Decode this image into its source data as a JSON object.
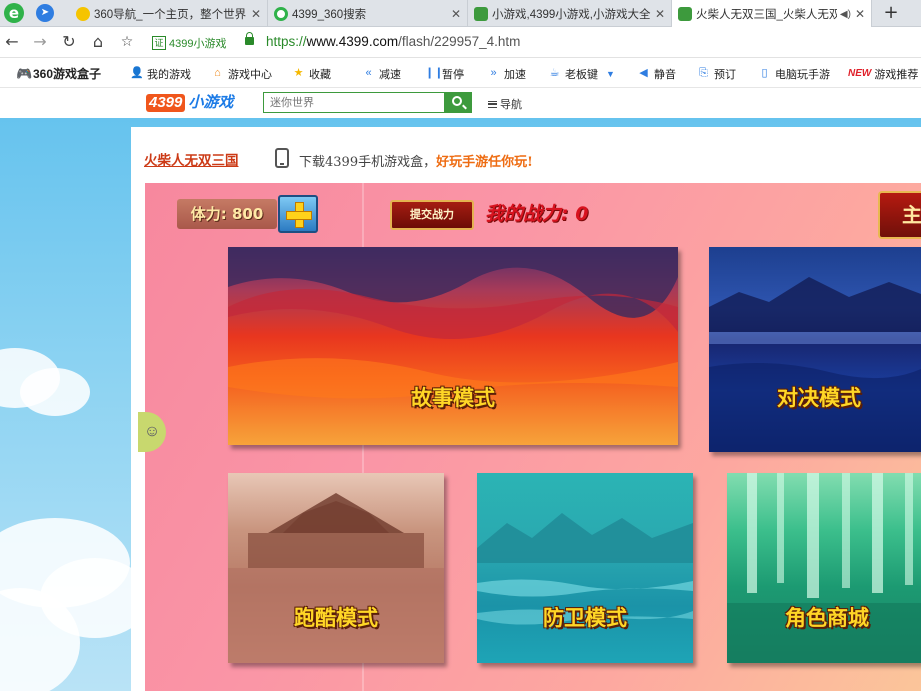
{
  "tabs": [
    {
      "title": "360导航_一个主页，整个世界",
      "favicon_color": "#f5c400"
    },
    {
      "title": "4399_360搜索",
      "favicon_color": "#2fb24a"
    },
    {
      "title": "小游戏,4399小游戏,小游戏大全",
      "favicon_color": "#3d9a3d"
    },
    {
      "title": "火柴人无双三国_火柴人无双",
      "favicon_color": "#3d9a3d",
      "active": true
    }
  ],
  "tab_close_glyph": "✕",
  "new_tab_glyph": "+",
  "address": {
    "cert_label": "4399小游戏",
    "url_scheme": "https://",
    "url_host": "www.4399.com",
    "url_path": "/flash/229957_4.htm"
  },
  "bookmarks": [
    {
      "label": "360游戏盒子",
      "icon": "gamepad-icon",
      "color": "#e0202a"
    },
    {
      "label": "我的游戏",
      "icon": "user-icon",
      "color": "#2f7de1"
    },
    {
      "label": "游戏中心",
      "icon": "home-icon",
      "color": "#f08a1c"
    },
    {
      "label": "收藏",
      "icon": "star-icon",
      "color": "#f5b800"
    },
    {
      "label": "减速",
      "icon": "rewind-icon",
      "color": "#2f7de1"
    },
    {
      "label": "暂停",
      "icon": "pause-icon",
      "color": "#2f7de1"
    },
    {
      "label": "加速",
      "icon": "fast-forward-icon",
      "color": "#2f7de1"
    },
    {
      "label": "老板键",
      "icon": "boss-key-icon",
      "color": "#2f7de1"
    },
    {
      "label": "静音",
      "icon": "speaker-icon",
      "color": "#2f7de1"
    },
    {
      "label": "预订",
      "icon": "reserve-icon",
      "color": "#2f7de1"
    },
    {
      "label": "电脑玩手游",
      "icon": "phone-icon",
      "color": "#2f7de1"
    },
    {
      "label": "游戏推荐",
      "icon": "new-tag-icon",
      "color": "#e0202a",
      "tag": "NEW"
    }
  ],
  "site": {
    "logo_number": "4399",
    "logo_text": "小游戏",
    "search_placeholder": "迷你世界",
    "nav_label": "导航"
  },
  "game": {
    "title": "火柴人无双三国",
    "promo_prefix": "下载4399手机游戏盒，",
    "promo_highlight": "好玩手游任你玩!",
    "stamina": "体力: 800",
    "submit_label": "提交战力",
    "power": "我的战力: 0",
    "corner_label": "主",
    "modes": [
      {
        "label": "故事模式"
      },
      {
        "label": "对决模式"
      },
      {
        "label": "跑酷模式"
      },
      {
        "label": "防卫模式"
      },
      {
        "label": "角色商城"
      }
    ]
  }
}
